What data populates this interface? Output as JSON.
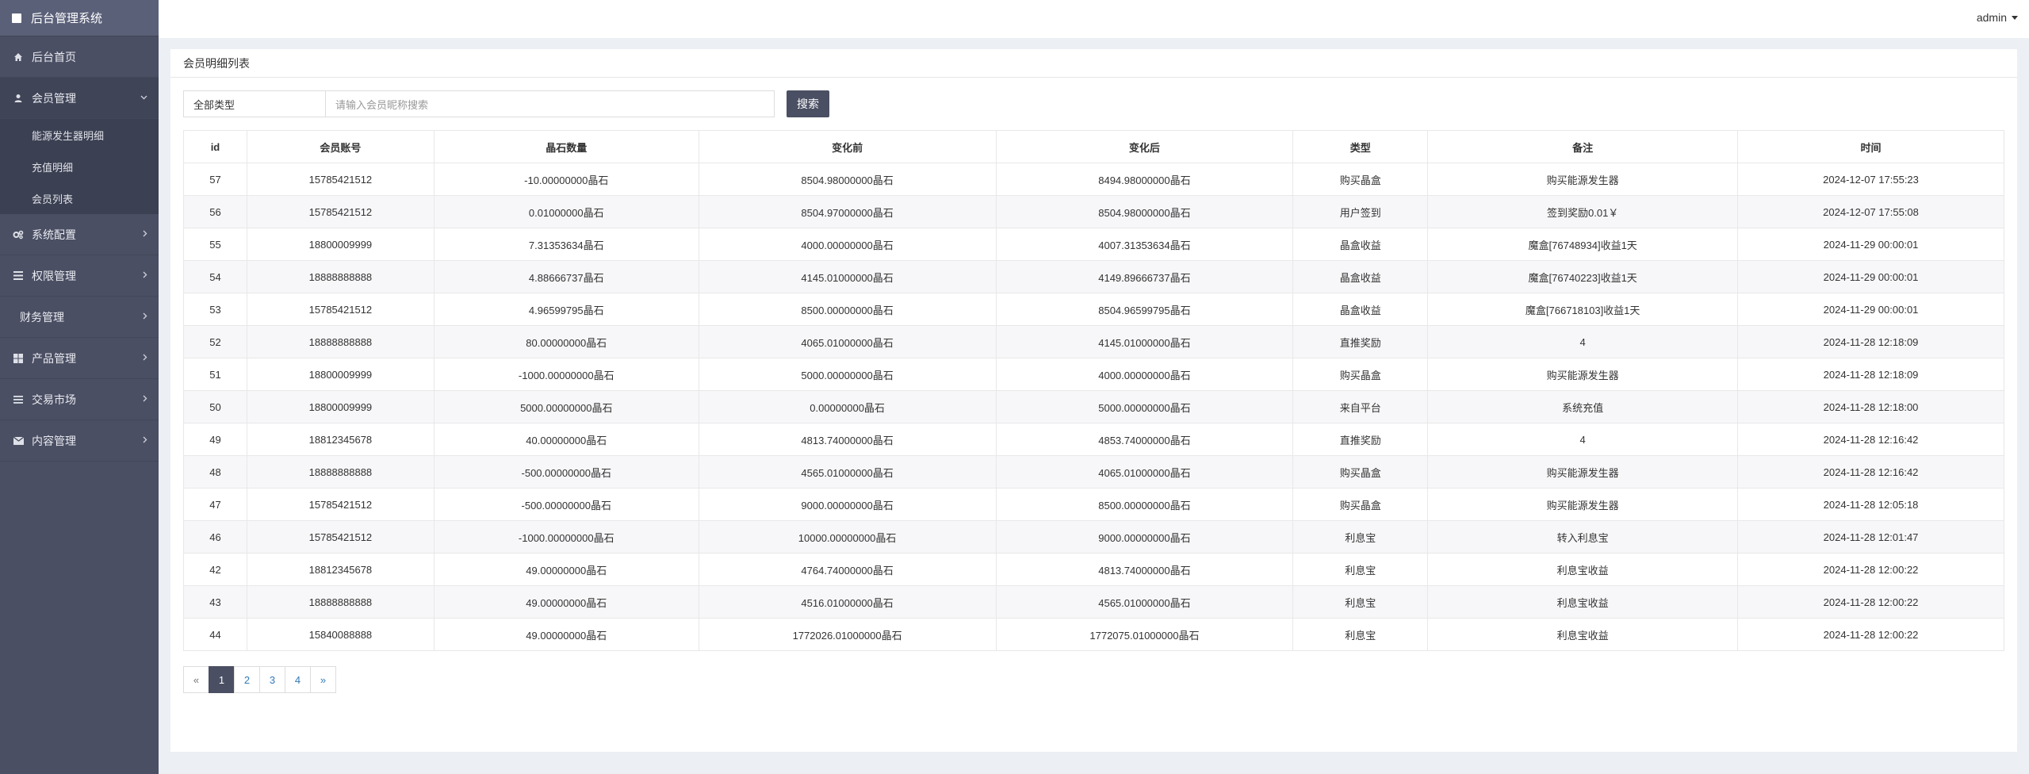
{
  "brand": {
    "title": "后台管理系统"
  },
  "sidebar": {
    "items": [
      {
        "label": "后台首页",
        "icon": "home-icon"
      },
      {
        "label": "会员管理",
        "icon": "user-icon",
        "open": true,
        "children": [
          "能源发生器明细",
          "充值明细",
          "会员列表"
        ]
      },
      {
        "label": "系统配置",
        "icon": "gears-icon"
      },
      {
        "label": "权限管理",
        "icon": "list-icon"
      },
      {
        "label": "财务管理",
        "icon": ""
      },
      {
        "label": "产品管理",
        "icon": "windows-icon"
      },
      {
        "label": "交易市场",
        "icon": "bars-icon"
      },
      {
        "label": "内容管理",
        "icon": "envelope-icon"
      }
    ]
  },
  "topbar": {
    "user": "admin"
  },
  "panel": {
    "title": "会员明细列表"
  },
  "filters": {
    "type_select": "全部类型",
    "search_placeholder": "请输入会员昵称搜索",
    "search_button": "搜索"
  },
  "table": {
    "headers": [
      "id",
      "会员账号",
      "晶石数量",
      "变化前",
      "变化后",
      "类型",
      "备注",
      "时间"
    ],
    "rows": [
      [
        "57",
        "15785421512",
        "-10.00000000晶石",
        "8504.98000000晶石",
        "8494.98000000晶石",
        "购买晶盒",
        "购买能源发生器",
        "2024-12-07 17:55:23"
      ],
      [
        "56",
        "15785421512",
        "0.01000000晶石",
        "8504.97000000晶石",
        "8504.98000000晶石",
        "用户签到",
        "签到奖励0.01￥",
        "2024-12-07 17:55:08"
      ],
      [
        "55",
        "18800009999",
        "7.31353634晶石",
        "4000.00000000晶石",
        "4007.31353634晶石",
        "晶盒收益",
        "魔盒[76748934]收益1天",
        "2024-11-29 00:00:01"
      ],
      [
        "54",
        "18888888888",
        "4.88666737晶石",
        "4145.01000000晶石",
        "4149.89666737晶石",
        "晶盒收益",
        "魔盒[76740223]收益1天",
        "2024-11-29 00:00:01"
      ],
      [
        "53",
        "15785421512",
        "4.96599795晶石",
        "8500.00000000晶石",
        "8504.96599795晶石",
        "晶盒收益",
        "魔盒[766718103]收益1天",
        "2024-11-29 00:00:01"
      ],
      [
        "52",
        "18888888888",
        "80.00000000晶石",
        "4065.01000000晶石",
        "4145.01000000晶石",
        "直推奖励",
        "4",
        "2024-11-28 12:18:09"
      ],
      [
        "51",
        "18800009999",
        "-1000.00000000晶石",
        "5000.00000000晶石",
        "4000.00000000晶石",
        "购买晶盒",
        "购买能源发生器",
        "2024-11-28 12:18:09"
      ],
      [
        "50",
        "18800009999",
        "5000.00000000晶石",
        "0.00000000晶石",
        "5000.00000000晶石",
        "来自平台",
        "系统充值",
        "2024-11-28 12:18:00"
      ],
      [
        "49",
        "18812345678",
        "40.00000000晶石",
        "4813.74000000晶石",
        "4853.74000000晶石",
        "直推奖励",
        "4",
        "2024-11-28 12:16:42"
      ],
      [
        "48",
        "18888888888",
        "-500.00000000晶石",
        "4565.01000000晶石",
        "4065.01000000晶石",
        "购买晶盒",
        "购买能源发生器",
        "2024-11-28 12:16:42"
      ],
      [
        "47",
        "15785421512",
        "-500.00000000晶石",
        "9000.00000000晶石",
        "8500.00000000晶石",
        "购买晶盒",
        "购买能源发生器",
        "2024-11-28 12:05:18"
      ],
      [
        "46",
        "15785421512",
        "-1000.00000000晶石",
        "10000.00000000晶石",
        "9000.00000000晶石",
        "利息宝",
        "转入利息宝",
        "2024-11-28 12:01:47"
      ],
      [
        "42",
        "18812345678",
        "49.00000000晶石",
        "4764.74000000晶石",
        "4813.74000000晶石",
        "利息宝",
        "利息宝收益",
        "2024-11-28 12:00:22"
      ],
      [
        "43",
        "18888888888",
        "49.00000000晶石",
        "4516.01000000晶石",
        "4565.01000000晶石",
        "利息宝",
        "利息宝收益",
        "2024-11-28 12:00:22"
      ],
      [
        "44",
        "15840088888",
        "49.00000000晶石",
        "1772026.01000000晶石",
        "1772075.01000000晶石",
        "利息宝",
        "利息宝收益",
        "2024-11-28 12:00:22"
      ]
    ]
  },
  "pagination": {
    "prev": "«",
    "pages": [
      "1",
      "2",
      "3",
      "4"
    ],
    "current": "1",
    "next": "»"
  }
}
